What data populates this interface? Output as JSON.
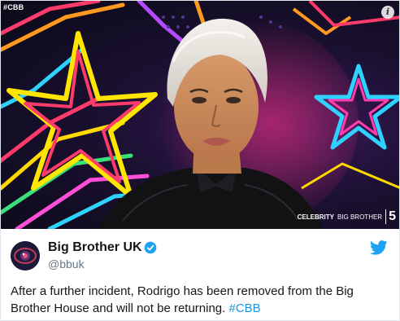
{
  "media": {
    "tag": "#CBB",
    "info_icon": "info-icon",
    "channel_brand_bold": "CELEBRITY",
    "channel_brand_light": "BIG BROTHER",
    "channel_number": "5"
  },
  "tweet": {
    "display_name": "Big Brother UK",
    "handle": "@bbuk",
    "verified": true,
    "text": "After a further incident, Rodrigo has been removed from the Big Brother House and will not be returning.",
    "hashtag": "#CBB",
    "colors": {
      "hashtag": "#1b95e0",
      "verified": "#1da1f2",
      "twitter_logo": "#1da1f2"
    },
    "icons": [
      "eye-logo-avatar",
      "verified-badge-icon",
      "twitter-bird-icon"
    ]
  }
}
